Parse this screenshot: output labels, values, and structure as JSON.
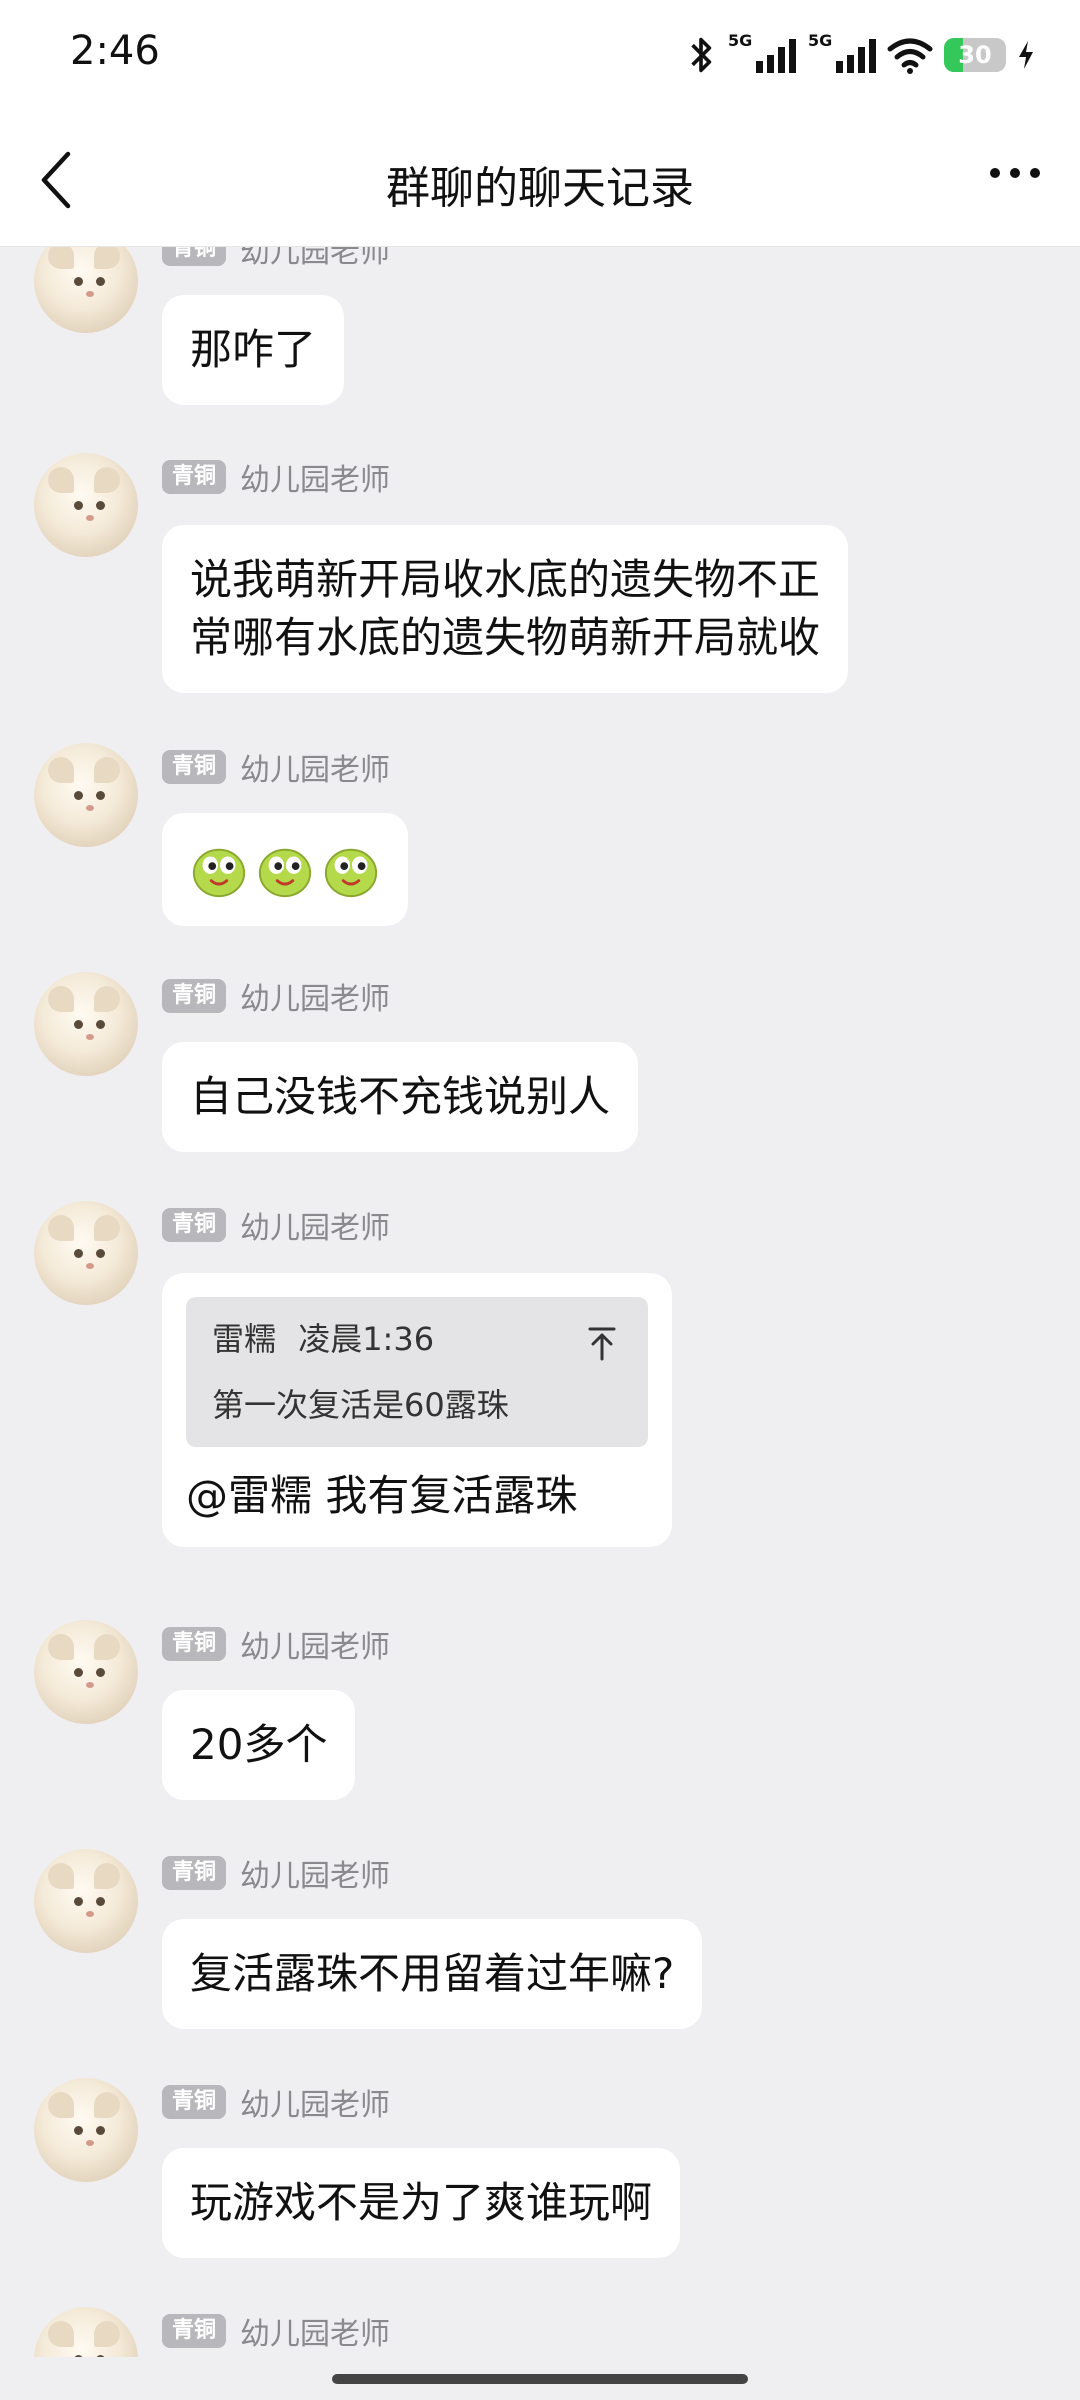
{
  "status_bar": {
    "time": "2:46",
    "network1": "5G",
    "network2": "5G",
    "battery": "30",
    "battery_level": 0.3
  },
  "nav": {
    "title": "群聊的聊天记录"
  },
  "messages": [
    {
      "badge": "青铜",
      "sender": "幼儿园老师",
      "text": "那咋了"
    },
    {
      "badge": "青铜",
      "sender": "幼儿园老师",
      "line1": "说我萌新开局收水底的遗失物不正",
      "line2": "常哪有水底的遗失物萌新开局就收"
    },
    {
      "badge": "青铜",
      "sender": "幼儿园老师",
      "emojis": [
        "smile-face",
        "smile-face",
        "smile-face"
      ]
    },
    {
      "badge": "青铜",
      "sender": "幼儿园老师",
      "text": "自己没钱不充钱说别人"
    },
    {
      "badge": "青铜",
      "sender": "幼儿园老师",
      "quote": {
        "author": "雷糯",
        "time": "凌晨1:36",
        "text": "第一次复活是60露珠"
      },
      "text": "@雷糯 我有复活露珠"
    },
    {
      "badge": "青铜",
      "sender": "幼儿园老师",
      "text": "20多个"
    },
    {
      "badge": "青铜",
      "sender": "幼儿园老师",
      "text": "复活露珠不用留着过年嘛?"
    },
    {
      "badge": "青铜",
      "sender": "幼儿园老师",
      "text": "玩游戏不是为了爽谁玩啊"
    },
    {
      "badge": "青铜",
      "sender": "幼儿园老师"
    }
  ],
  "colors": {
    "background": "#efeff2",
    "bubble": "#ffffff",
    "badge": "#b8b8bc",
    "battery_fill": "#34c759"
  }
}
